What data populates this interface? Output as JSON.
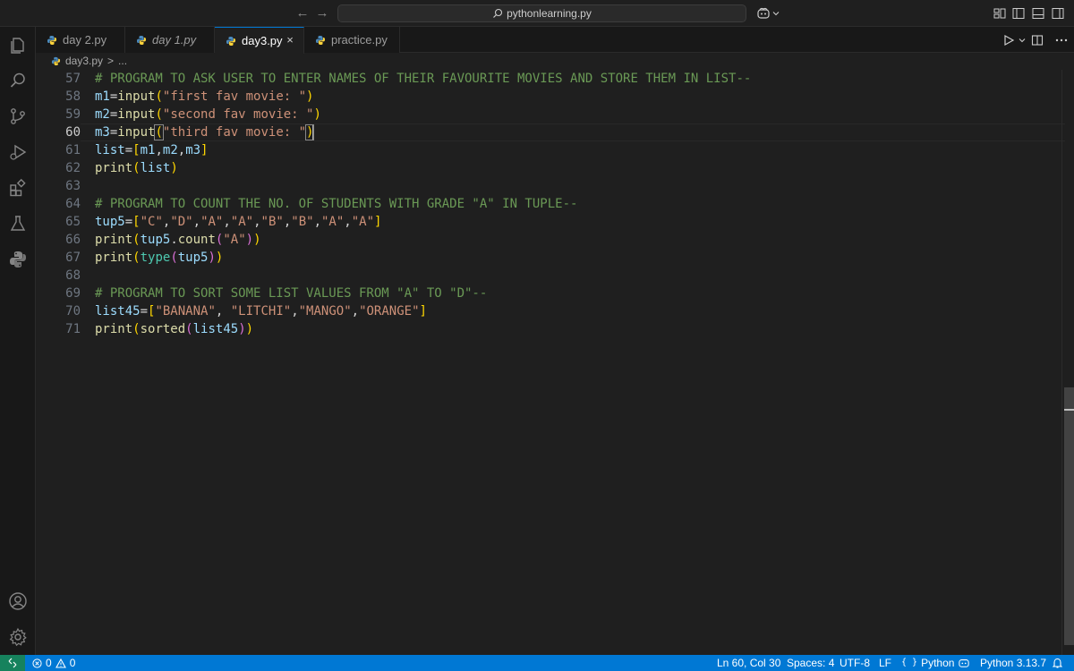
{
  "titlebar": {
    "search_text": "pythonlearning.py",
    "back_icon": "arrow-left-icon",
    "forward_icon": "arrow-right-icon"
  },
  "tabs": [
    {
      "label": "day 2.py",
      "active": false
    },
    {
      "label": "day 1.py",
      "active": false
    },
    {
      "label": "day3.py",
      "active": true
    },
    {
      "label": "practice.py",
      "active": false
    }
  ],
  "tab_close_glyph": "×",
  "breadcrumb": {
    "file": "day3.py",
    "separator": ">",
    "more": "..."
  },
  "editor": {
    "line_numbers": [
      "57",
      "58",
      "59",
      "60",
      "61",
      "62",
      "63",
      "64",
      "65",
      "66",
      "67",
      "68",
      "69",
      "70",
      "71"
    ],
    "current_line": "60"
  },
  "statusbar": {
    "errors": "0",
    "warnings": "0",
    "cursor": "Ln 60, Col 30",
    "spaces": "Spaces: 4",
    "encoding": "UTF-8",
    "eol": "LF",
    "language": "Python",
    "interpreter": "Python 3.13.7"
  },
  "colors": {
    "status_bar": "#0078d4",
    "remote": "#16825d",
    "comment": "#6a9955",
    "string": "#ce9178",
    "variable": "#9cdcfe",
    "function": "#dcdcaa"
  }
}
